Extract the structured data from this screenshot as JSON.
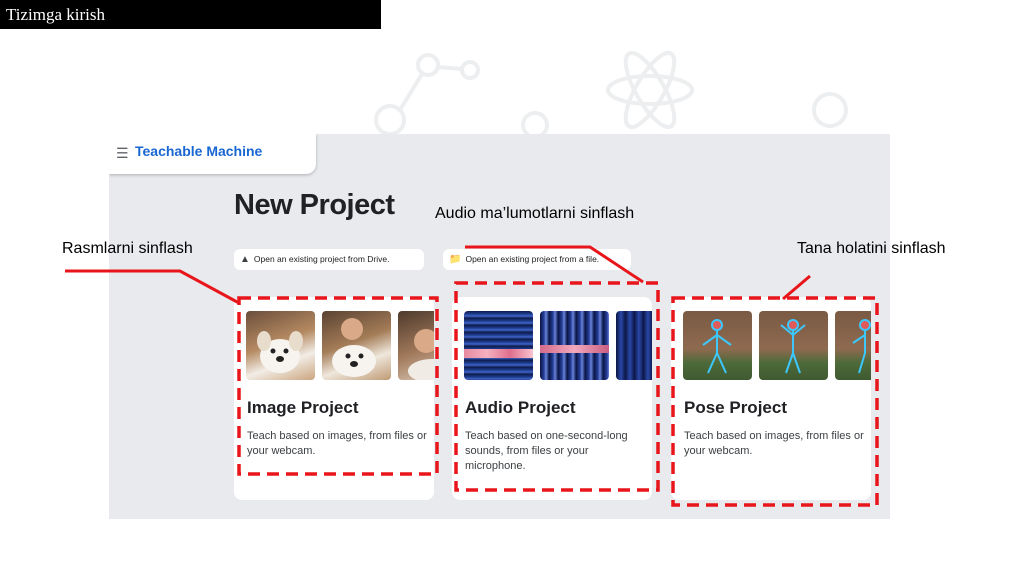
{
  "top_bar": {
    "title": "Tizimga kirish"
  },
  "app": {
    "name": "Teachable Machine",
    "page_title": "New Project",
    "actions": [
      {
        "label": "Open an existing project from Drive.",
        "icon": "drive-icon"
      },
      {
        "label": "Open an existing project from a file.",
        "icon": "folder-icon"
      }
    ],
    "cards": [
      {
        "title": "Image Project",
        "description": "Teach based on images, from files or your webcam."
      },
      {
        "title": "Audio Project",
        "description": "Teach based on one-second-long sounds, from files or your microphone."
      },
      {
        "title": "Pose Project",
        "description": "Teach based on images, from files or your webcam."
      }
    ]
  },
  "annotations": {
    "image": "Rasmlarni sinflash",
    "audio": "Audio ma’lumotlarni sinflash",
    "pose": "Tana holatini sinflash"
  },
  "colors": {
    "annotation": "#e8161b",
    "brand": "#1967d2",
    "background": "#e8eaed"
  }
}
